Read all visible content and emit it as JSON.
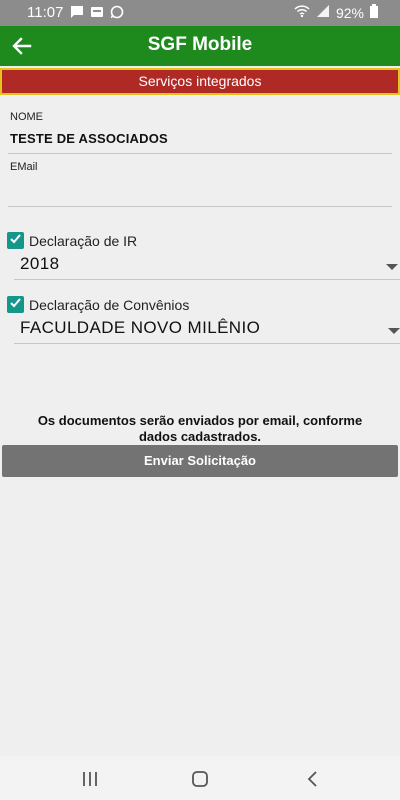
{
  "status_bar": {
    "time": "11:07",
    "battery": "92%",
    "icons": [
      "message-icon",
      "sms-icon",
      "whatsapp-icon",
      "wifi-icon",
      "signal-icon",
      "battery-icon"
    ]
  },
  "app_bar": {
    "title": "SGF Mobile",
    "color": "#1e8a1e"
  },
  "banner": {
    "text": "Serviços integrados",
    "color": "#b02a25",
    "border_color": "#e6c21a"
  },
  "form": {
    "nome_label": "NOME",
    "nome_value": "TESTE DE ASSOCIADOS",
    "email_label": "EMail",
    "email_value": ""
  },
  "declaracao_ir": {
    "label": "Declaração de IR",
    "checked": true,
    "selected": "2018"
  },
  "declaracao_convenios": {
    "label": "Declaração de Convênios",
    "checked": true,
    "selected": "FACULDADE NOVO MILÊNIO"
  },
  "info_text": "Os documentos serão enviados por email, conforme dados cadastrados.",
  "submit_label": "Enviar Solicitação",
  "accent_color": "#15968a"
}
